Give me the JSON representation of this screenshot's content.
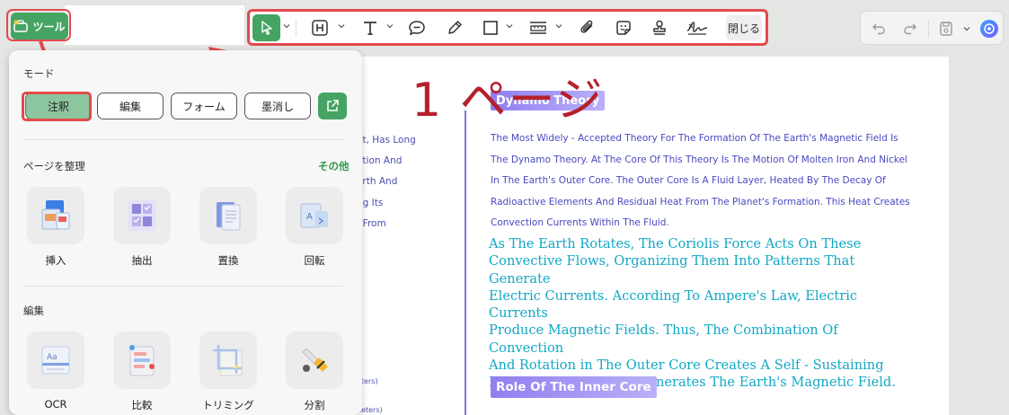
{
  "topbar": {
    "tool_button_label": "ツール",
    "close_label": "閉じる"
  },
  "icons": {
    "toolbar": [
      "select-cursor-icon",
      "highlight-h-icon",
      "text-t-icon",
      "comment-bubble-icon",
      "pencil-icon",
      "rectangle-icon",
      "measure-ruler-icon",
      "attach-paperclip-icon",
      "sticker-icon",
      "stamp-icon",
      "signature-icon"
    ],
    "right": [
      "undo-icon",
      "redo-icon",
      "save-icon",
      "ai-assistant-icon"
    ]
  },
  "colors": {
    "accent_green": "#45a463",
    "highlight_red": "#e34a4c",
    "annotation_red": "#b5202c",
    "doc_blue": "#4a48c0",
    "doc_teal": "#12a8c4",
    "heading_purple": "#8f7ff0"
  },
  "annotation": {
    "page_label": "1 ページ"
  },
  "panel": {
    "mode_title": "モード",
    "modes": [
      "注釈",
      "編集",
      "フォーム",
      "墨消し"
    ],
    "organize_title": "ページを整理",
    "organize_more": "その他",
    "organize_tools": [
      "挿入",
      "抽出",
      "置換",
      "回転"
    ],
    "edit_title": "編集",
    "edit_tools": [
      "OCR",
      "比較",
      "トリミング",
      "分割"
    ]
  },
  "document": {
    "left_fragments": [
      "et, Has Long",
      "ation And",
      "arth And",
      "ng Its",
      ", From",
      "eters)",
      "neters)"
    ],
    "heading1": "Dynamo Theory",
    "paragraph1_lines": [
      "The Most Widely - Accepted Theory For The Formation Of The Earth's Magnetic Field Is",
      "The Dynamo Theory. At The Core Of This Theory Is The Motion Of Molten Iron And Nickel",
      "In The Earth's Outer Core. The Outer Core Is A Fluid Layer, Heated By The Decay Of",
      "Radioactive Elements And Residual Heat From The Planet's Formation. This Heat Creates",
      "Convection Currents Within The Fluid."
    ],
    "paragraph2_lines": [
      "As The Earth Rotates, The Coriolis Force Acts On These",
      "Convective Flows, Organizing Them Into Patterns That Generate",
      "Electric Currents. According To Ampere's Law, Electric Currents",
      "Produce Magnetic Fields. Thus, The Combination Of Convection",
      "And Rotation in The Outer Core Creates A Self - Sustaining",
      "Dynamo Process That Generates The Earth's Magnetic Field."
    ],
    "heading2": "Role Of The Inner Core"
  }
}
